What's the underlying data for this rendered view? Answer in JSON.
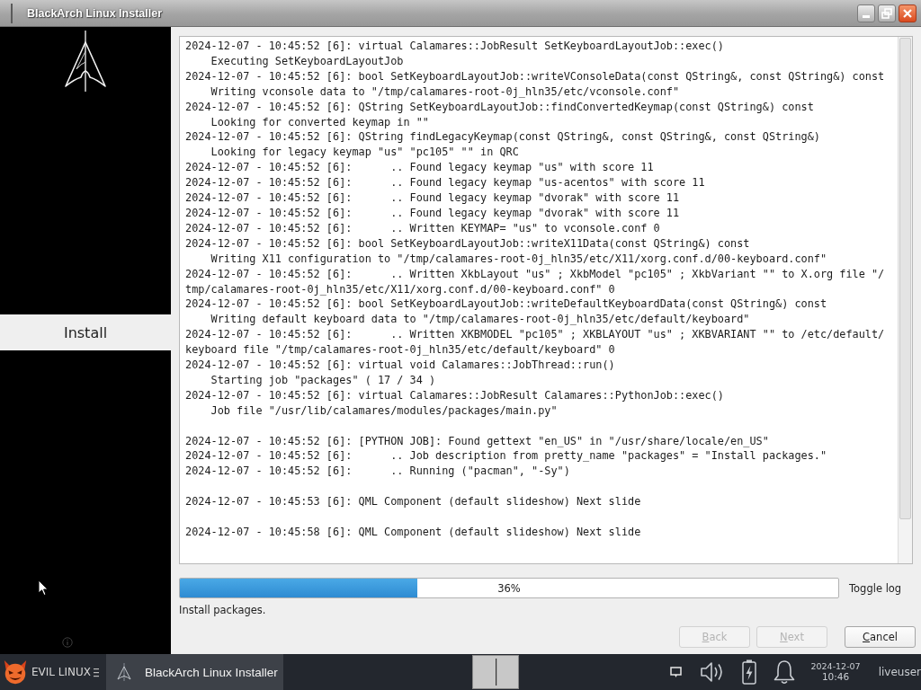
{
  "window": {
    "title": "BlackArch Linux Installer"
  },
  "sidebar": {
    "steps": [
      {
        "label": "Install",
        "selected": true
      }
    ]
  },
  "log": {
    "blocks": [
      [
        "2024-12-07 - 10:45:52 [6]: virtual Calamares::JobResult SetKeyboardLayoutJob::exec()",
        "    Executing SetKeyboardLayoutJob",
        "2024-12-07 - 10:45:52 [6]: bool SetKeyboardLayoutJob::writeVConsoleData(const QString&, const QString&) const",
        "    Writing vconsole data to \"/tmp/calamares-root-0j_hln35/etc/vconsole.conf\"",
        "2024-12-07 - 10:45:52 [6]: QString SetKeyboardLayoutJob::findConvertedKeymap(const QString&) const",
        "    Looking for converted keymap in \"\"",
        "2024-12-07 - 10:45:52 [6]: QString findLegacyKeymap(const QString&, const QString&, const QString&)",
        "    Looking for legacy keymap \"us\" \"pc105\" \"\" in QRC",
        "2024-12-07 - 10:45:52 [6]:      .. Found legacy keymap \"us\" with score 11",
        "2024-12-07 - 10:45:52 [6]:      .. Found legacy keymap \"us-acentos\" with score 11",
        "2024-12-07 - 10:45:52 [6]:      .. Found legacy keymap \"dvorak\" with score 11",
        "2024-12-07 - 10:45:52 [6]:      .. Found legacy keymap \"dvorak\" with score 11",
        "2024-12-07 - 10:45:52 [6]:      .. Written KEYMAP= \"us\" to vconsole.conf 0",
        "2024-12-07 - 10:45:52 [6]: bool SetKeyboardLayoutJob::writeX11Data(const QString&) const",
        "    Writing X11 configuration to \"/tmp/calamares-root-0j_hln35/etc/X11/xorg.conf.d/00-keyboard.conf\"",
        "2024-12-07 - 10:45:52 [6]:      .. Written XkbLayout \"us\" ; XkbModel \"pc105\" ; XkbVariant \"\" to X.org file \"/",
        "tmp/calamares-root-0j_hln35/etc/X11/xorg.conf.d/00-keyboard.conf\" 0",
        "2024-12-07 - 10:45:52 [6]: bool SetKeyboardLayoutJob::writeDefaultKeyboardData(const QString&) const",
        "    Writing default keyboard data to \"/tmp/calamares-root-0j_hln35/etc/default/keyboard\"",
        "2024-12-07 - 10:45:52 [6]:      .. Written XKBMODEL \"pc105\" ; XKBLAYOUT \"us\" ; XKBVARIANT \"\" to /etc/default/",
        "keyboard file \"/tmp/calamares-root-0j_hln35/etc/default/keyboard\" 0",
        "2024-12-07 - 10:45:52 [6]: virtual void Calamares::JobThread::run()",
        "    Starting job \"packages\" ( 17 / 34 )",
        "2024-12-07 - 10:45:52 [6]: virtual Calamares::JobResult Calamares::PythonJob::exec()",
        "    Job file \"/usr/lib/calamares/modules/packages/main.py\""
      ],
      [
        "2024-12-07 - 10:45:52 [6]: [PYTHON JOB]: Found gettext \"en_US\" in \"/usr/share/locale/en_US\"",
        "2024-12-07 - 10:45:52 [6]:      .. Job description from pretty_name \"packages\" = \"Install packages.\"",
        "2024-12-07 - 10:45:52 [6]:      .. Running (\"pacman\", \"-Sy\")"
      ],
      [
        "2024-12-07 - 10:45:53 [6]: QML Component (default slideshow) Next slide"
      ],
      [
        "2024-12-07 - 10:45:58 [6]: QML Component (default slideshow) Next slide"
      ]
    ]
  },
  "progress": {
    "level": 0.36,
    "label": "36%"
  },
  "toggle_log": "Toggle log",
  "status": "Install packages.",
  "buttons": [
    {
      "label": "Back",
      "disabled": true
    },
    {
      "label": "Next",
      "disabled": true
    },
    {
      "label": "Cancel",
      "disabled": false
    }
  ],
  "taskbar": {
    "start_label": "EVIL LINUX",
    "tasks": [
      {
        "label": "BlackArch Linux Installer",
        "selected": true
      }
    ],
    "clock": {
      "date": "2024-12-07",
      "time": "10:46"
    },
    "user": "liveuser"
  }
}
